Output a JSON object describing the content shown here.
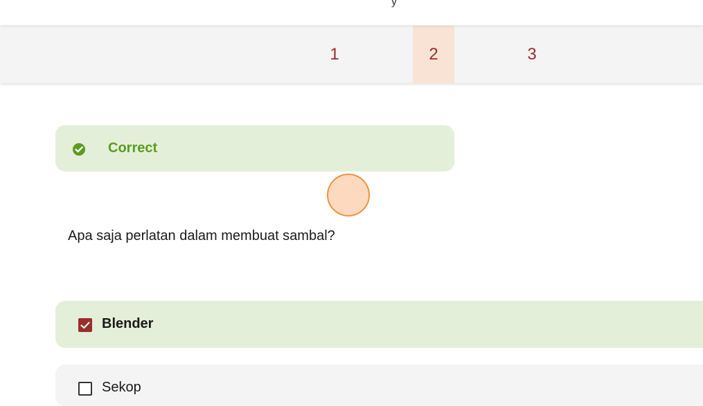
{
  "topbar": {
    "glyph": "y"
  },
  "pagination": {
    "pages": [
      "1",
      "2",
      "3"
    ],
    "active_page": "2"
  },
  "feedback": {
    "status": "Correct",
    "icon": "check-circle-icon",
    "color": "#5a9c1e",
    "background": "#e4efd9"
  },
  "question": {
    "text": "Apa saja perlatan dalam membuat sambal?"
  },
  "options": [
    {
      "label": "Blender",
      "checked": true
    },
    {
      "label": "Sekop",
      "checked": false
    }
  ],
  "colors": {
    "accent": "#9b2d2a",
    "active_tab": "#f9e3d5",
    "cursor_fill": "#fdd9c0",
    "cursor_border": "#f0923f"
  }
}
